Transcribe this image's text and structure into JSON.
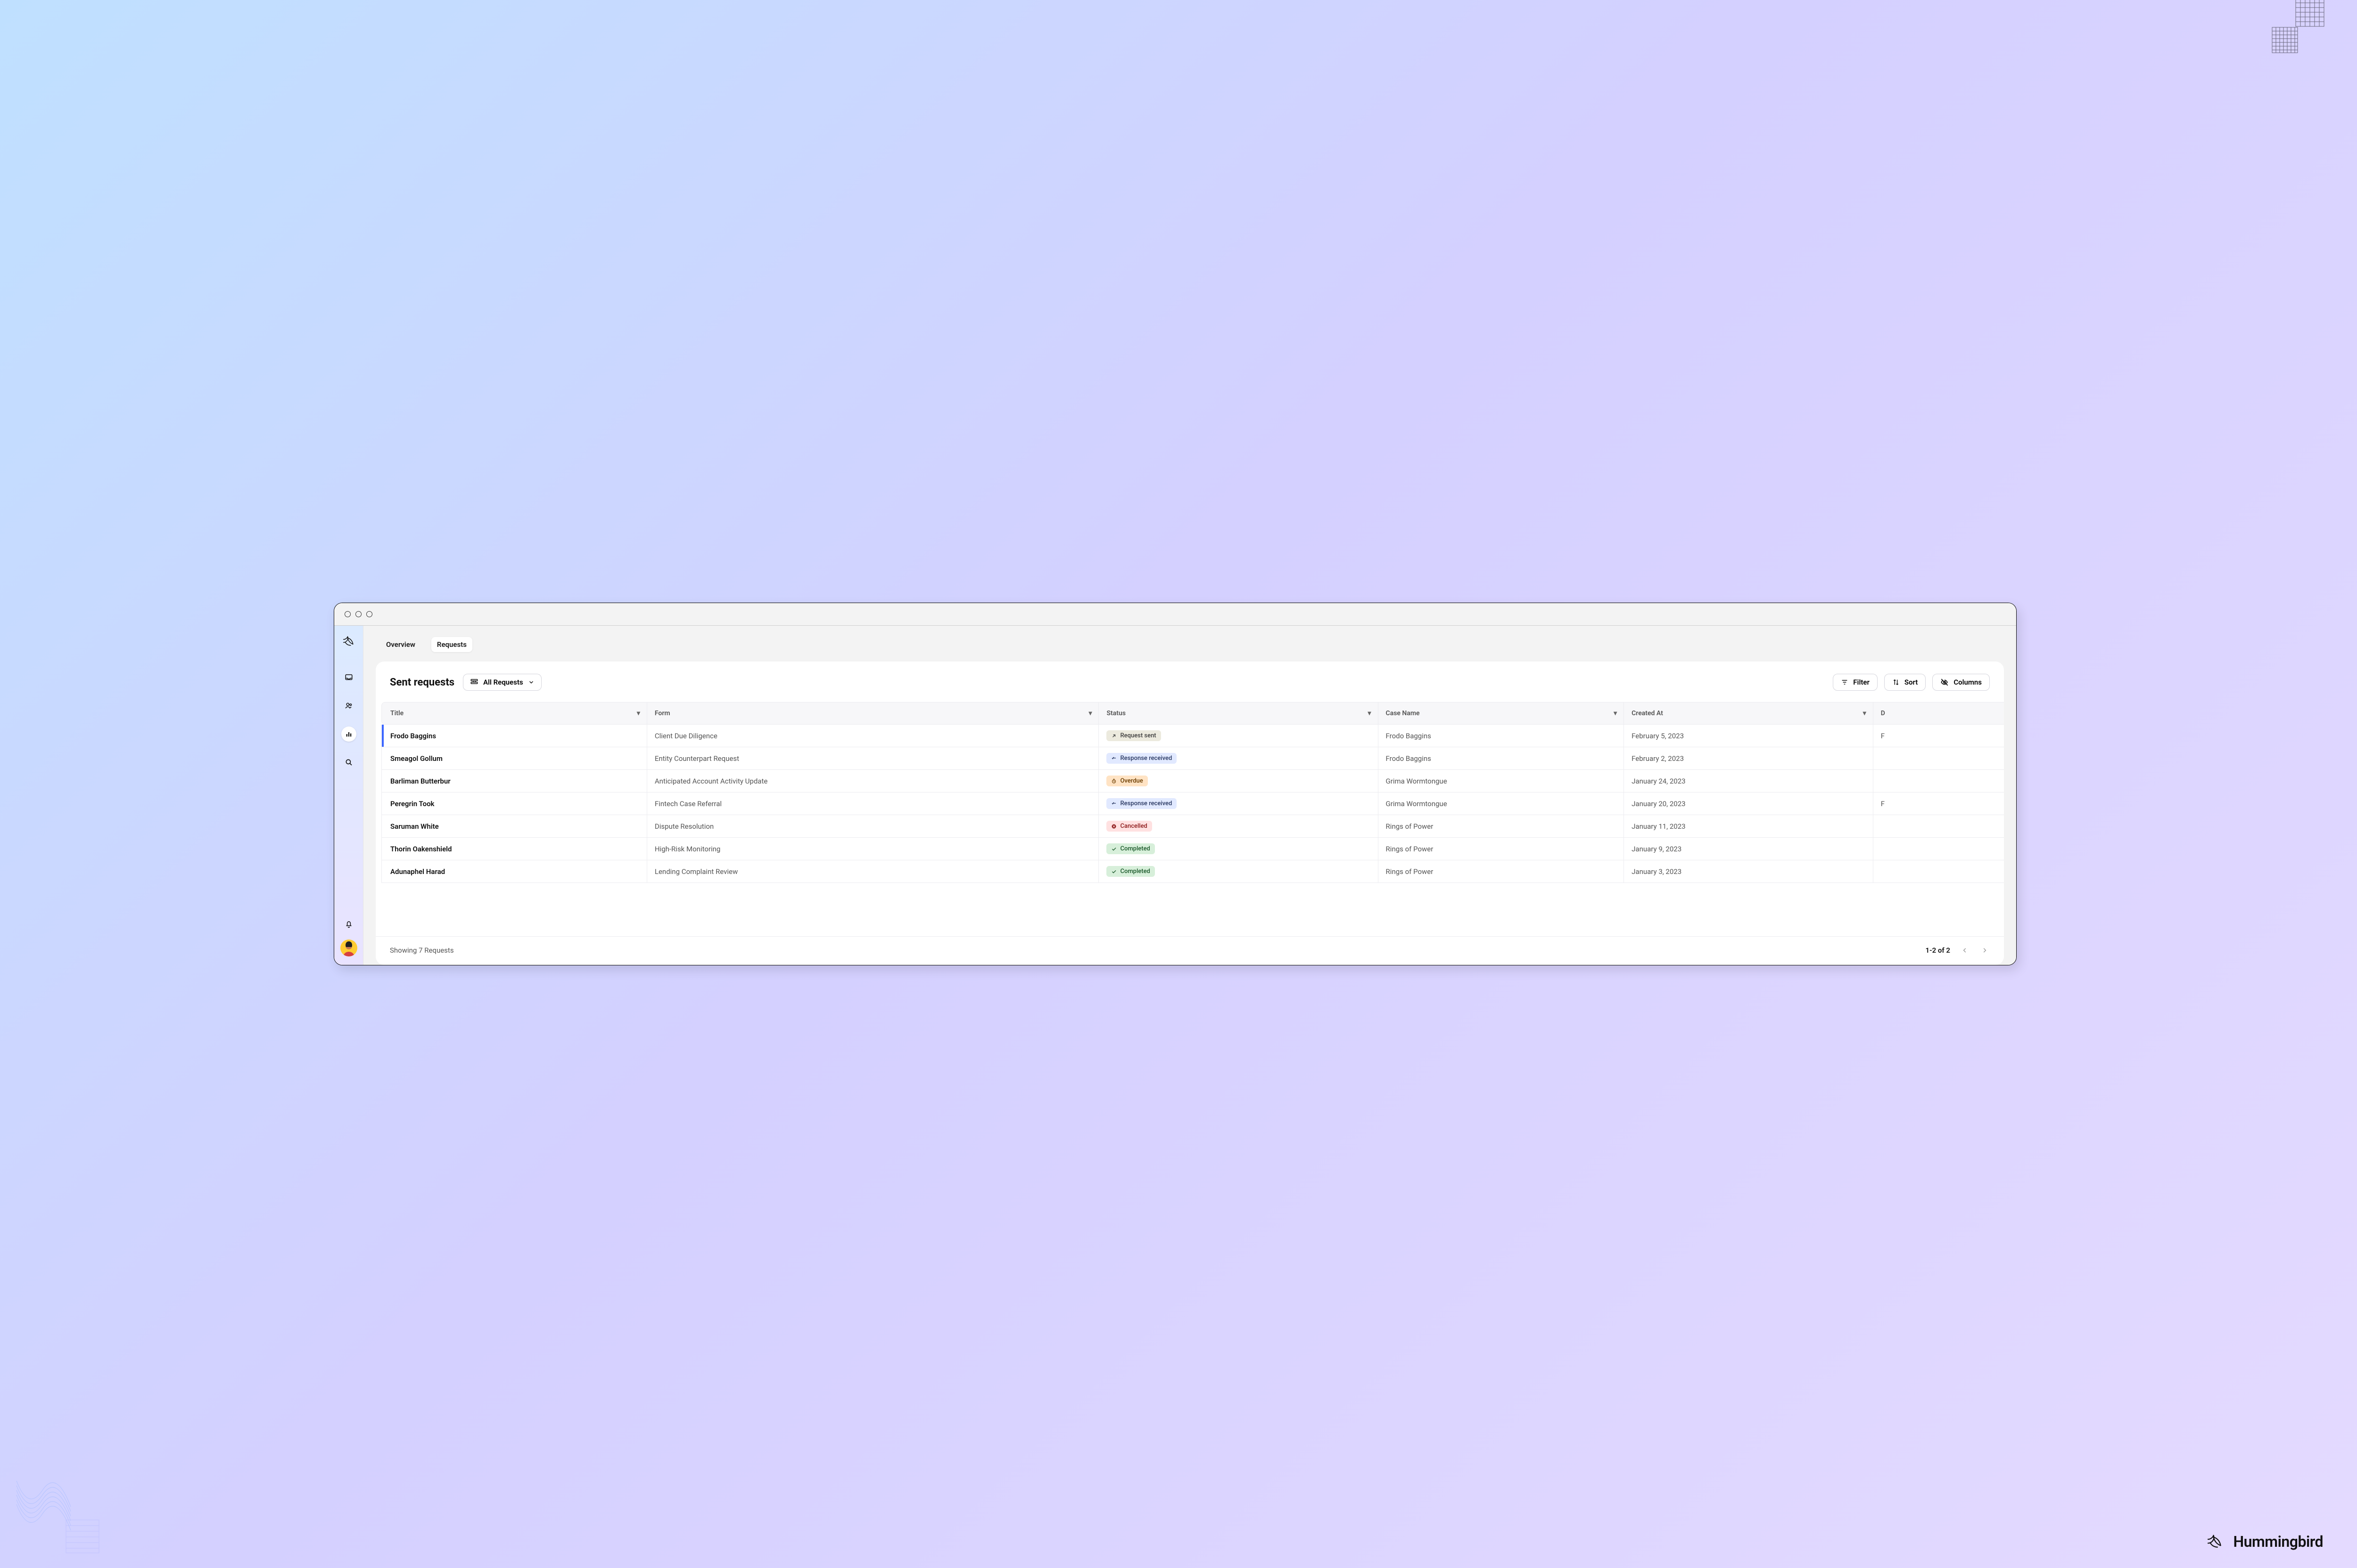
{
  "brand": "Hummingbird",
  "tabs": {
    "overview": "Overview",
    "requests": "Requests"
  },
  "page": {
    "title": "Sent requests",
    "scope_label": "All Requests",
    "actions": {
      "filter": "Filter",
      "sort": "Sort",
      "columns": "Columns"
    }
  },
  "columns": {
    "title": "Title",
    "form": "Form",
    "status": "Status",
    "case": "Case Name",
    "created": "Created At",
    "extra": "D"
  },
  "rows": [
    {
      "title": "Frodo Baggins",
      "form": "Client Due Diligence",
      "status_kind": "sent",
      "status_label": "Request sent",
      "case": "Frodo Baggins",
      "created": "February 5, 2023",
      "extra": "F",
      "selected": true
    },
    {
      "title": "Smeagol Gollum",
      "form": "Entity Counterpart Request",
      "status_kind": "response",
      "status_label": "Response received",
      "case": "Frodo Baggins",
      "created": "February 2, 2023",
      "extra": ""
    },
    {
      "title": "Barliman Butterbur",
      "form": "Anticipated Account Activity Update",
      "status_kind": "overdue",
      "status_label": "Overdue",
      "case": "Grima Wormtongue",
      "created": "January 24, 2023",
      "extra": ""
    },
    {
      "title": "Peregrin Took",
      "form": "Fintech Case Referral",
      "status_kind": "response",
      "status_label": "Response received",
      "case": "Grima Wormtongue",
      "created": "January 20, 2023",
      "extra": "F"
    },
    {
      "title": "Saruman White",
      "form": "Dispute Resolution",
      "status_kind": "cancelled",
      "status_label": "Cancelled",
      "case": "Rings of Power",
      "created": "January 11, 2023",
      "extra": ""
    },
    {
      "title": "Thorin Oakenshield",
      "form": "High-Risk Monitoring",
      "status_kind": "completed",
      "status_label": "Completed",
      "case": "Rings of Power",
      "created": "January 9, 2023",
      "extra": ""
    },
    {
      "title": "Adunaphel Harad",
      "form": "Lending Complaint Review",
      "status_kind": "completed",
      "status_label": "Completed",
      "case": "Rings of Power",
      "created": "January 3, 2023",
      "extra": ""
    }
  ],
  "footer": {
    "summary": "Showing 7 Requests",
    "range": "1-2 of 2"
  }
}
